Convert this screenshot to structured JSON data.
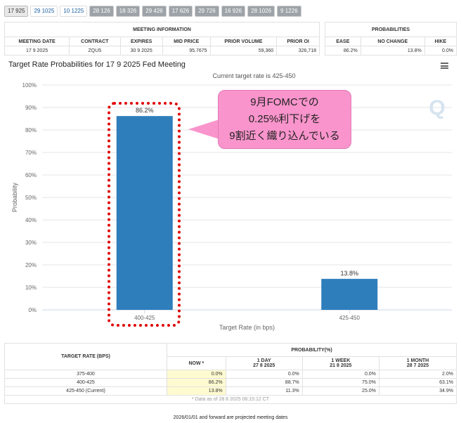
{
  "tabs": [
    "17 925",
    "29 1025",
    "10 1225",
    "28 126",
    "18 326",
    "29 426",
    "17 626",
    "29 726",
    "16 926",
    "28 1026",
    "9 1226"
  ],
  "meeting_info": {
    "group_label": "MEETING INFORMATION",
    "headers": [
      "MEETING DATE",
      "CONTRACT",
      "EXPIRES",
      "MID PRICE",
      "PRIOR VOLUME",
      "PRIOR OI"
    ],
    "row": [
      "17 9 2025",
      "ZQU5",
      "30 9 2025",
      "95.7675",
      "59,360",
      "326,718"
    ]
  },
  "probabilities": {
    "group_label": "PROBABILITIES",
    "headers": [
      "EASE",
      "NO CHANGE",
      "HIKE"
    ],
    "row": [
      "86.2%",
      "13.8%",
      "0.0%"
    ]
  },
  "chart_title": "Target Rate Probabilities for 17 9 2025 Fed Meeting",
  "callout": {
    "line1": "9月FOMCでの",
    "line2": "0.25%利下げを",
    "line3": "9割近く織り込んでいる"
  },
  "chart_data": {
    "type": "bar",
    "subtitle": "Current target rate is 425-450",
    "xlabel": "Target Rate (in bps)",
    "ylabel": "Probability",
    "categories": [
      "400-425",
      "425-450"
    ],
    "values": [
      86.2,
      13.8
    ],
    "data_labels": [
      "86.2%",
      "13.8%"
    ],
    "ylim": [
      0,
      100
    ],
    "yticks": [
      "0%",
      "10%",
      "20%",
      "30%",
      "40%",
      "50%",
      "60%",
      "70%",
      "80%",
      "90%",
      "100%"
    ],
    "grid": true,
    "bar_color": "#2f7ebc",
    "watermark": "Q"
  },
  "bottom_table": {
    "col1_header": "TARGET RATE (BPS)",
    "group_header": "PROBABILITY(%)",
    "cols": [
      {
        "label": "NOW *",
        "date": ""
      },
      {
        "label": "1 DAY",
        "date": "27 8 2025"
      },
      {
        "label": "1 WEEK",
        "date": "21 8 2025"
      },
      {
        "label": "1 MONTH",
        "date": "28 7 2025"
      }
    ],
    "rows": [
      {
        "rate": "375-400",
        "vals": [
          "0.0%",
          "0.0%",
          "0.0%",
          "2.0%"
        ]
      },
      {
        "rate": "400-425",
        "vals": [
          "86.2%",
          "88.7%",
          "75.0%",
          "63.1%"
        ]
      },
      {
        "rate": "425-450 (Current)",
        "vals": [
          "13.8%",
          "11.3%",
          "25.0%",
          "34.9%"
        ]
      }
    ],
    "note": "* Data as of 28 8 2025 08:15:12 CT"
  },
  "footer": "2026/01/01 and forward are projected meeting dates"
}
